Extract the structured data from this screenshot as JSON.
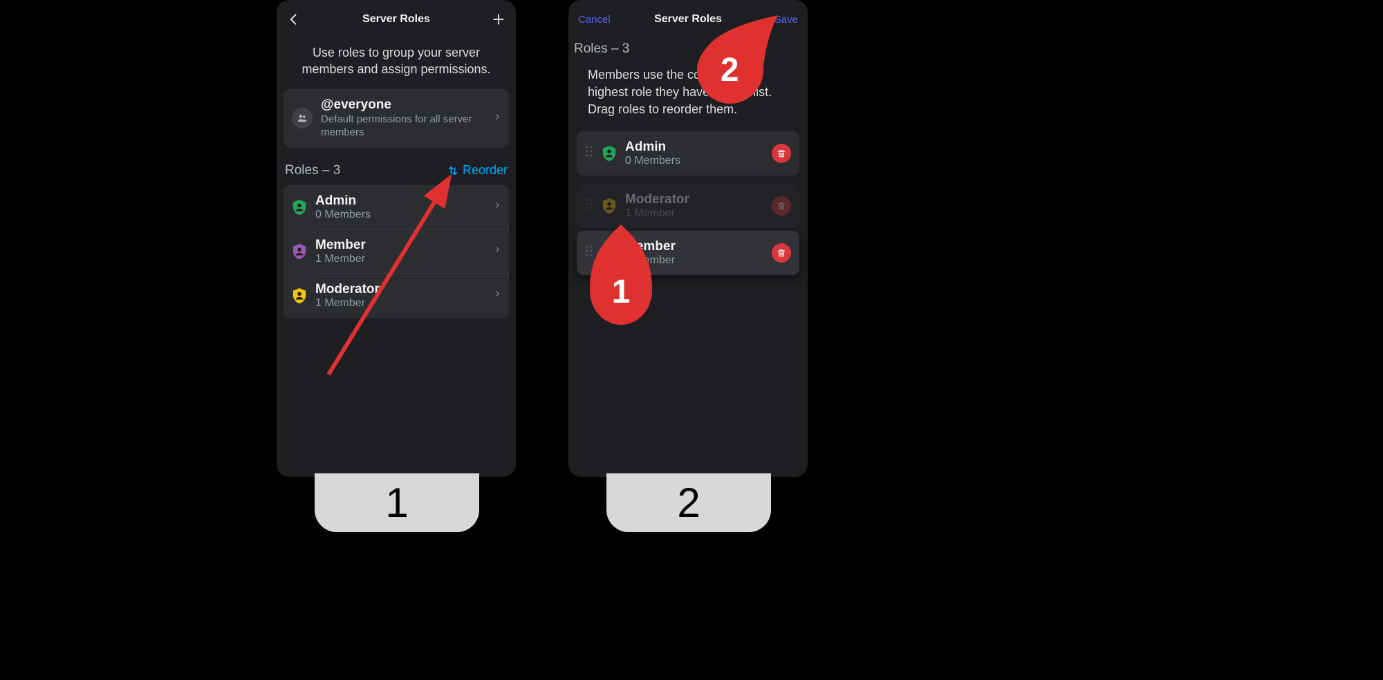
{
  "screen1": {
    "title": "Server Roles",
    "description": "Use roles to group your server members and assign permissions.",
    "everyone": {
      "name": "@everyone",
      "sub": "Default permissions for all server members"
    },
    "roles_header": "Roles – 3",
    "reorder_label": "Reorder",
    "roles": [
      {
        "name": "Admin",
        "members": "0 Members",
        "color": "#23a559"
      },
      {
        "name": "Member",
        "members": "1 Member",
        "color": "#9b59b6"
      },
      {
        "name": "Moderator",
        "members": "1 Member",
        "color": "#f1c40f"
      }
    ]
  },
  "screen2": {
    "cancel": "Cancel",
    "title": "Server Roles",
    "save": "Save",
    "roles_header": "Roles – 3",
    "description": "Members use the colour of the highest role they have on this list. Drag roles to reorder them.",
    "roles": [
      {
        "name": "Admin",
        "members": "0 Members",
        "color": "#23a559"
      },
      {
        "name": "Moderator",
        "members": "1 Member",
        "color": "#f1c40f"
      },
      {
        "name": "Member",
        "members": "1 Member",
        "color": "#5865f2"
      }
    ]
  },
  "labels": {
    "one": "1",
    "two": "2"
  },
  "annotations": {
    "pin1": "1",
    "pin2": "2"
  }
}
